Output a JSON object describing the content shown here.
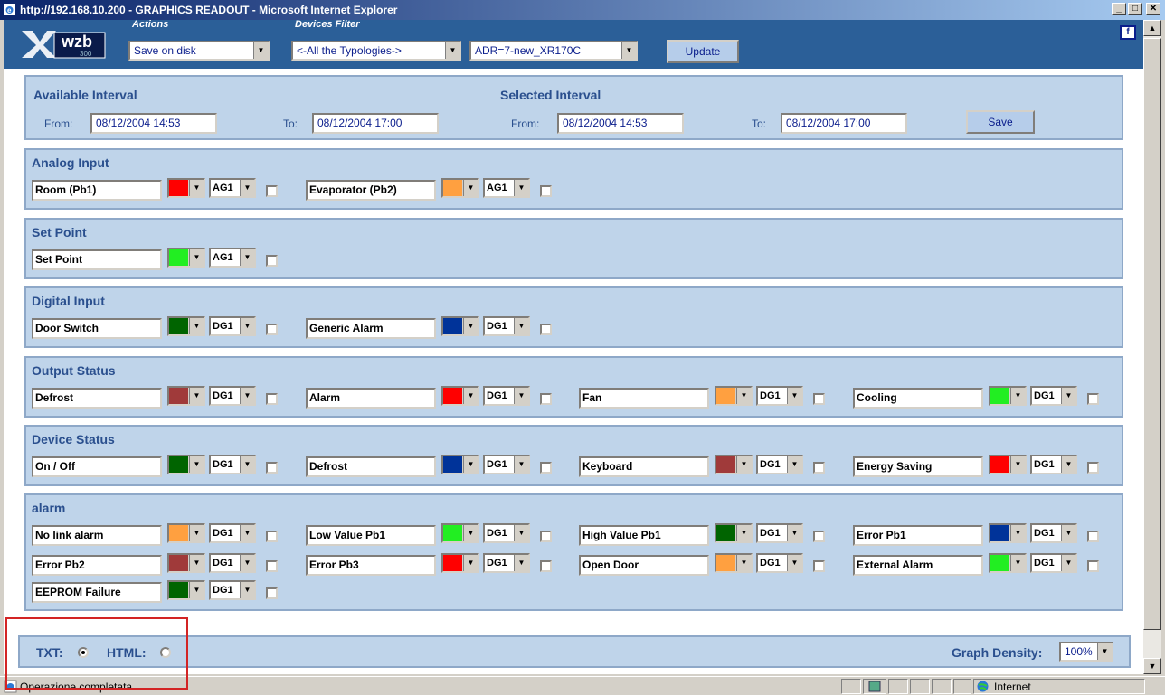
{
  "window": {
    "title": "http://192.168.10.200 - GRAPHICS READOUT - Microsoft Internet Explorer",
    "min": "_",
    "max": "□",
    "close": "✕"
  },
  "header": {
    "logo_text": "wzb",
    "logo_sub": "300",
    "actions_caption": "Actions",
    "actions_value": "Save on disk",
    "filter_caption": "Devices Filter",
    "typology_value": "<-All the Typologies->",
    "device_value": "ADR=7-new_XR170C",
    "update_label": "Update",
    "help_label": "f"
  },
  "intervals": {
    "available_title": "Available Interval",
    "selected_title": "Selected Interval",
    "from_label": "From:",
    "to_label": "To:",
    "available_from": "08/12/2004 14:53",
    "available_to": "08/12/2004 17:00",
    "selected_from": "08/12/2004 14:53",
    "selected_to": "08/12/2004 17:00",
    "save_label": "Save"
  },
  "sections": [
    {
      "title": "Analog Input",
      "rows": [
        [
          {
            "name": "Room (Pb1)",
            "color": "#ff0000",
            "group": "AG1"
          },
          {
            "name": "Evaporator (Pb2)",
            "color": "#ffa040",
            "group": "AG1"
          }
        ]
      ]
    },
    {
      "title": "Set Point",
      "rows": [
        [
          {
            "name": "Set Point",
            "color": "#22ee22",
            "group": "AG1"
          }
        ]
      ]
    },
    {
      "title": "Digital Input",
      "rows": [
        [
          {
            "name": "Door Switch",
            "color": "#006400",
            "group": "DG1"
          },
          {
            "name": "Generic Alarm",
            "color": "#003399",
            "group": "DG1"
          }
        ]
      ]
    },
    {
      "title": "Output Status",
      "rows": [
        [
          {
            "name": "Defrost",
            "color": "#a03a3a",
            "group": "DG1"
          },
          {
            "name": "Alarm",
            "color": "#ff0000",
            "group": "DG1"
          },
          {
            "name": "Fan",
            "color": "#ffa040",
            "group": "DG1"
          },
          {
            "name": "Cooling",
            "color": "#22ee22",
            "group": "DG1"
          }
        ]
      ]
    },
    {
      "title": "Device Status",
      "rows": [
        [
          {
            "name": "On / Off",
            "color": "#006400",
            "group": "DG1"
          },
          {
            "name": "Defrost",
            "color": "#003399",
            "group": "DG1"
          },
          {
            "name": "Keyboard",
            "color": "#a03a3a",
            "group": "DG1"
          },
          {
            "name": "Energy Saving",
            "color": "#ff0000",
            "group": "DG1"
          }
        ]
      ]
    },
    {
      "title": "alarm",
      "rows": [
        [
          {
            "name": "No link alarm",
            "color": "#ffa040",
            "group": "DG1"
          },
          {
            "name": "Low Value Pb1",
            "color": "#22ee22",
            "group": "DG1"
          },
          {
            "name": "High Value Pb1",
            "color": "#006400",
            "group": "DG1"
          },
          {
            "name": "Error Pb1",
            "color": "#003399",
            "group": "DG1"
          }
        ],
        [
          {
            "name": "Error Pb2",
            "color": "#a03a3a",
            "group": "DG1"
          },
          {
            "name": "Error Pb3",
            "color": "#ff0000",
            "group": "DG1"
          },
          {
            "name": "Open Door",
            "color": "#ffa040",
            "group": "DG1"
          },
          {
            "name": "External Alarm",
            "color": "#22ee22",
            "group": "DG1"
          }
        ],
        [
          {
            "name": "EEPROM Failure",
            "color": "#006400",
            "group": "DG1"
          }
        ]
      ]
    }
  ],
  "footer": {
    "txt_label": "TXT:",
    "html_label": "HTML:",
    "selected_format": "TXT",
    "density_label": "Graph Density:",
    "density_value": "100%"
  },
  "status": {
    "text": "Operazione completata",
    "zone": "Internet"
  }
}
